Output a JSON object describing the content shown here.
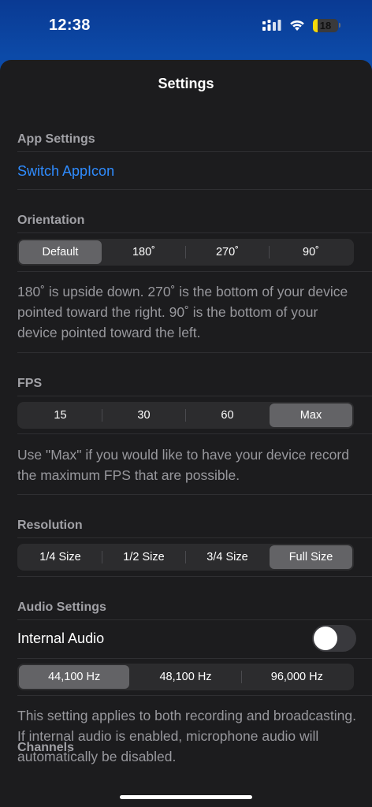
{
  "status_bar": {
    "time": "12:38",
    "battery_level": 18,
    "battery_text": "18"
  },
  "sheet": {
    "title": "Settings"
  },
  "app_settings": {
    "header": "App Settings",
    "switch_icon_label": "Switch AppIcon"
  },
  "orientation": {
    "header": "Orientation",
    "options": [
      "Default",
      "180˚",
      "270˚",
      "90˚"
    ],
    "selected_index": 0,
    "note": "180˚ is upside down. 270˚ is the bottom of your device pointed toward the right. 90˚ is the bottom of your device pointed toward the left."
  },
  "fps": {
    "header": "FPS",
    "options": [
      "15",
      "30",
      "60",
      "Max"
    ],
    "selected_index": 3,
    "note": "Use \"Max\" if you would like to have your device record the maximum FPS that are possible."
  },
  "resolution": {
    "header": "Resolution",
    "options": [
      "1/4 Size",
      "1/2 Size",
      "3/4 Size",
      "Full Size"
    ],
    "selected_index": 3
  },
  "audio_settings": {
    "header": "Audio Settings",
    "internal_audio_label": "Internal Audio",
    "internal_audio_on": false,
    "sample_rates": [
      "44,100 Hz",
      "48,100 Hz",
      "96,000 Hz"
    ],
    "selected_index": 0,
    "note": "This setting applies to both recording and broadcasting. If internal audio is enabled, microphone audio will automatically be disabled."
  },
  "channels": {
    "header": "Channels"
  },
  "colors": {
    "accent": "#2f8cff",
    "selected_segment": "#636366",
    "battery": "#f5d90a"
  }
}
